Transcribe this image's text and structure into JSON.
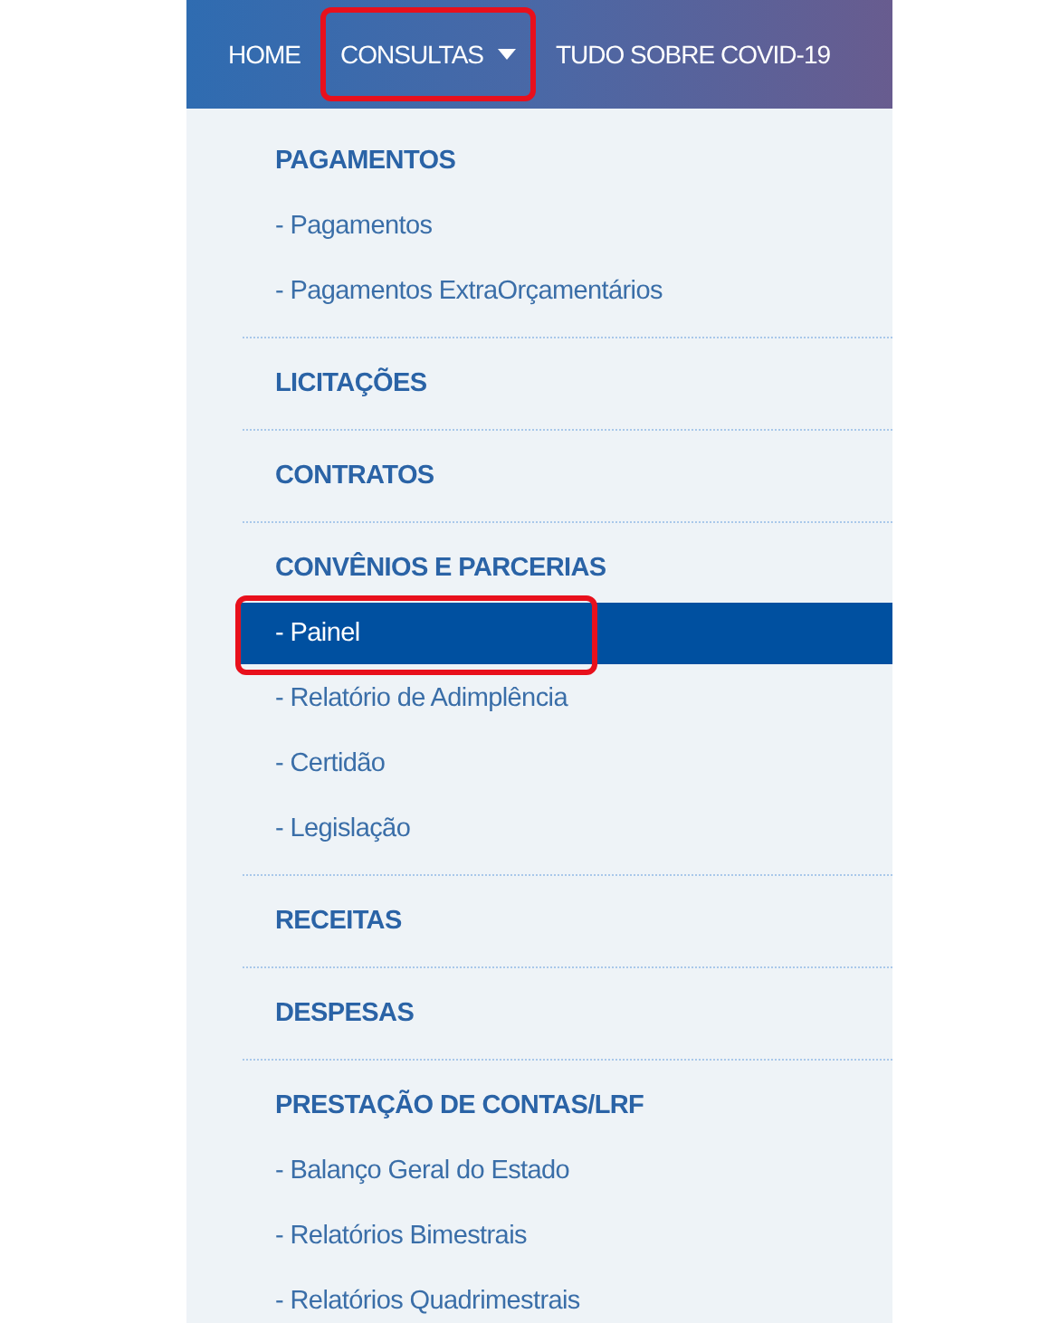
{
  "nav": {
    "items": [
      {
        "label": "HOME",
        "dropdown": false,
        "highlighted": false
      },
      {
        "label": "CONSULTAS",
        "dropdown": true,
        "highlighted": true
      },
      {
        "label": "TUDO SOBRE COVID-19",
        "dropdown": false,
        "highlighted": false
      }
    ]
  },
  "menu": {
    "sections": [
      {
        "heading": "PAGAMENTOS",
        "items": [
          {
            "label": "- Pagamentos",
            "selected": false,
            "highlighted": false
          },
          {
            "label": "- Pagamentos ExtraOrçamentários",
            "selected": false,
            "highlighted": false
          }
        ]
      },
      {
        "heading": "LICITAÇÕES"
      },
      {
        "heading": "CONTRATOS"
      },
      {
        "heading": "CONVÊNIOS E PARCERIAS",
        "items": [
          {
            "label": "- Painel",
            "selected": true,
            "highlighted": true
          },
          {
            "label": "- Relatório de Adimplência",
            "selected": false,
            "highlighted": false
          },
          {
            "label": "- Certidão",
            "selected": false,
            "highlighted": false
          },
          {
            "label": "- Legislação",
            "selected": false,
            "highlighted": false
          }
        ]
      },
      {
        "heading": "RECEITAS"
      },
      {
        "heading": "DESPESAS"
      },
      {
        "heading": "PRESTAÇÃO DE CONTAS/LRF",
        "items": [
          {
            "label": "- Balanço Geral do Estado",
            "selected": false,
            "highlighted": false
          },
          {
            "label": "- Relatórios Bimestrais",
            "selected": false,
            "highlighted": false
          },
          {
            "label": "- Relatórios Quadrimestrais",
            "selected": false,
            "highlighted": false
          }
        ]
      }
    ]
  }
}
